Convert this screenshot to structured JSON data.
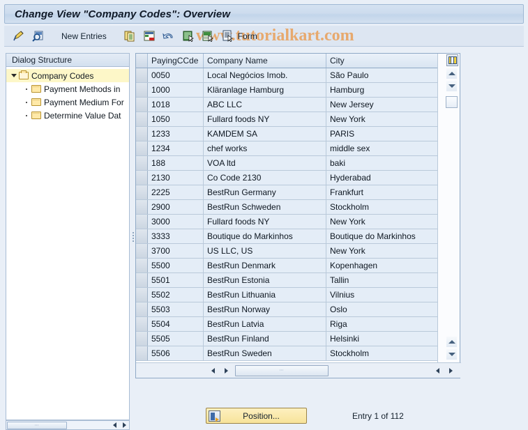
{
  "window": {
    "title": "Change View \"Company Codes\": Overview"
  },
  "watermark": "www.tutorialkart.com",
  "toolbar": {
    "display_change_icon": "display-change-pencil-icon",
    "check_icon": "check-entries-magnifier-icon",
    "new_entries_label": "New Entries",
    "copy_icon": "copy-as-icon",
    "delete_icon": "delete-row-icon",
    "undo_icon": "undo-change-icon",
    "select_all_icon": "select-all-icon",
    "deselect_all_icon": "deselect-all-icon",
    "form_icon": "form-document-icon",
    "form_label": "Form"
  },
  "sidebar": {
    "header": "Dialog Structure",
    "items": [
      {
        "label": "Company Codes",
        "level": 0,
        "selected": true,
        "expanded": true
      },
      {
        "label": "Payment Methods in",
        "level": 1,
        "selected": false,
        "expanded": false
      },
      {
        "label": "Payment Medium For",
        "level": 1,
        "selected": false,
        "expanded": false
      },
      {
        "label": "Determine Value Dat",
        "level": 1,
        "selected": false,
        "expanded": false
      }
    ]
  },
  "table": {
    "columns": [
      "PayingCCde",
      "Company Name",
      "City"
    ],
    "config_icon": "column-config-icon",
    "rows": [
      {
        "code": "0050",
        "name": "Local Negócios Imob.",
        "city": "São Paulo"
      },
      {
        "code": "1000",
        "name": "Kläranlage Hamburg",
        "city": "Hamburg"
      },
      {
        "code": "1018",
        "name": "ABC LLC",
        "city": "New Jersey"
      },
      {
        "code": "1050",
        "name": "Fullard foods NY",
        "city": "New York"
      },
      {
        "code": "1233",
        "name": "KAMDEM SA",
        "city": "PARIS"
      },
      {
        "code": "1234",
        "name": "chef works",
        "city": "middle sex"
      },
      {
        "code": "188",
        "name": "VOA ltd",
        "city": "baki"
      },
      {
        "code": "2130",
        "name": "Co Code 2130",
        "city": "Hyderabad"
      },
      {
        "code": "2225",
        "name": "BestRun Germany",
        "city": "Frankfurt"
      },
      {
        "code": "2900",
        "name": "BestRun Schweden",
        "city": "Stockholm"
      },
      {
        "code": "3000",
        "name": "Fullard foods NY",
        "city": "New York"
      },
      {
        "code": "3333",
        "name": "Boutique do Markinhos",
        "city": "Boutique do Markinhos"
      },
      {
        "code": "3700",
        "name": "US LLC, US",
        "city": "New York"
      },
      {
        "code": "5500",
        "name": "BestRun Denmark",
        "city": "Kopenhagen"
      },
      {
        "code": "5501",
        "name": "BestRun Estonia",
        "city": "Tallin"
      },
      {
        "code": "5502",
        "name": "BestRun Lithuania",
        "city": "Vilnius"
      },
      {
        "code": "5503",
        "name": "BestRun Norway",
        "city": "Oslo"
      },
      {
        "code": "5504",
        "name": "BestRun Latvia",
        "city": "Riga"
      },
      {
        "code": "5505",
        "name": "BestRun Finland",
        "city": "Helsinki"
      },
      {
        "code": "5506",
        "name": "BestRun Sweden",
        "city": "Stockholm"
      }
    ]
  },
  "footer": {
    "position_label": "Position...",
    "entry_info": "Entry 1 of 112"
  }
}
